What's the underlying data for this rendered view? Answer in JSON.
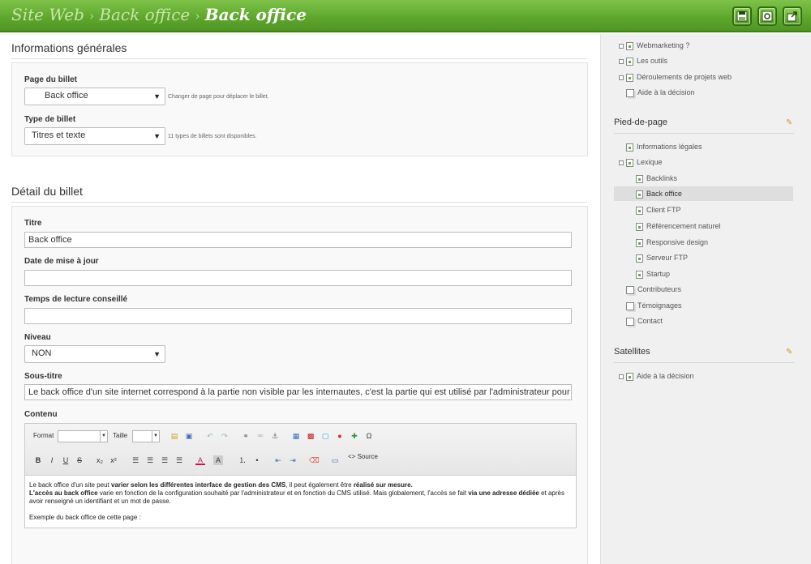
{
  "header": {
    "breadcrumb": [
      "Site Web",
      "Back office",
      "Back office"
    ],
    "separator": "›",
    "buttons": [
      {
        "name": "save-icon"
      },
      {
        "name": "preview-icon"
      },
      {
        "name": "exit-icon"
      }
    ]
  },
  "general": {
    "title": "Informations générales",
    "page_label": "Page du billet",
    "page_value": "Back office",
    "page_hint": "Changer de page pour déplacer le billet.",
    "type_label": "Type de billet",
    "type_value": "Titres et texte",
    "type_hint": "11 types de billets sont disponibles."
  },
  "detail": {
    "title": "Détail du billet",
    "titre_label": "Titre",
    "titre_value": "Back office",
    "date_label": "Date de mise à jour",
    "date_value": "",
    "temps_label": "Temps de lecture conseillé",
    "temps_value": "",
    "niveau_label": "Niveau",
    "niveau_value": "NON",
    "sous_titre_label": "Sous-titre",
    "sous_titre_value": "Le back office d'un site internet correspond à la partie non visible par les internautes, c'est la partie qui est utilisé par l'administrateur pour",
    "contenu_label": "Contenu"
  },
  "editor": {
    "format_label": "Format",
    "taille_label": "Taille",
    "source_label": "Source",
    "content": {
      "p1_a": "Le back office d'un site peut ",
      "p1_b": "varier selon les différentes interface de gestion des CMS",
      "p1_c": ", il peut également être ",
      "p1_d": "réalisé sur mesure.",
      "p2_a": "L'accès au back office",
      "p2_b": " varie en fonction de la configuration souhaité par l'administrateur et en fonction du CMS utilisé. Mais globalement, l'accès se fait ",
      "p2_c": "via une adresse dédiée",
      "p2_d": " et après avoir renseigné un identifiant et un mot de passe.",
      "p3": "Exemple du back office de cette page :"
    }
  },
  "sidebar": {
    "top_items": [
      "Webmarketing ?",
      "Les outils",
      "Déroulements de projets web",
      "Aide à la décision"
    ],
    "pied_title": "Pied-de-page",
    "pied_items": [
      "Informations légales",
      "Lexique"
    ],
    "lexique_items": [
      "Backlinks",
      "Back office",
      "Client FTP",
      "Référencement naturel",
      "Responsive design",
      "Serveur FTP",
      "Startup"
    ],
    "pied_more": [
      "Contributeurs",
      "Témoignages",
      "Contact"
    ],
    "satellites_title": "Satellites",
    "satellites_items": [
      "Aide à la décision"
    ]
  }
}
